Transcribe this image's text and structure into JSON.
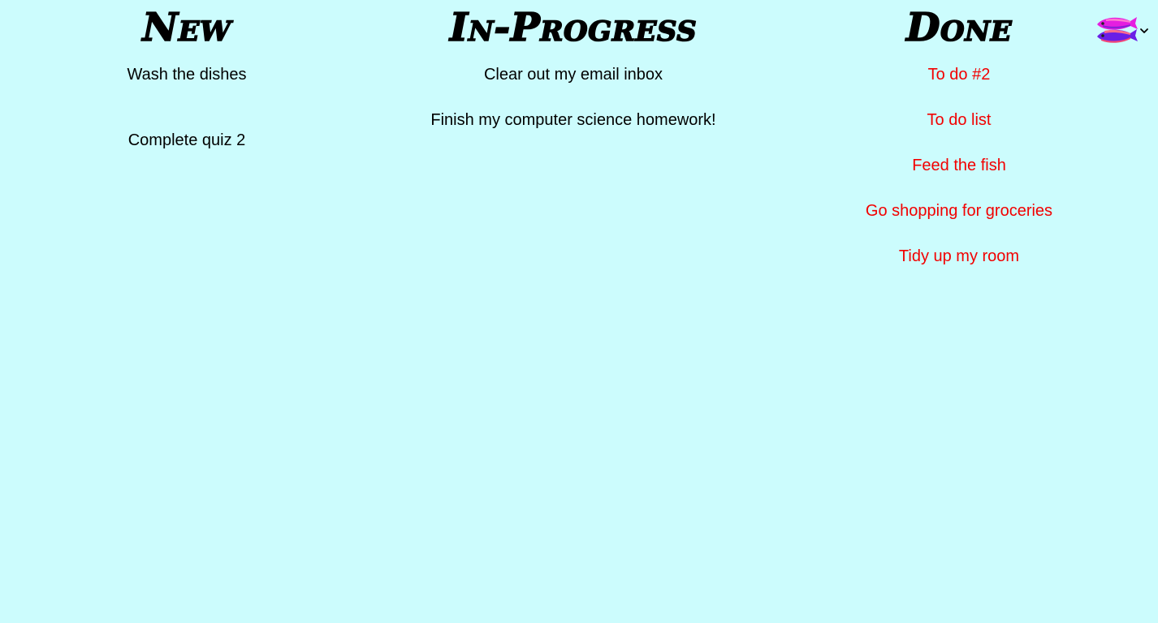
{
  "board": {
    "columns": [
      {
        "title": "New",
        "tasks": [
          "Wash the dishes",
          "Complete quiz 2"
        ]
      },
      {
        "title": "In-Progress",
        "tasks": [
          "Clear out my email inbox",
          "Finish my computer science homework!"
        ]
      },
      {
        "title": "Done",
        "tasks": [
          "To do #2",
          "To do list",
          "Feed the fish",
          "Go shopping for groceries",
          "Tidy up my room"
        ]
      }
    ]
  },
  "colors": {
    "background": "#ccfcfd",
    "done_task": "#f20000",
    "text": "#000000"
  },
  "account_menu": {
    "avatar_icon": "fish-logo-icon",
    "dropdown_icon": "chevron-down-icon"
  }
}
